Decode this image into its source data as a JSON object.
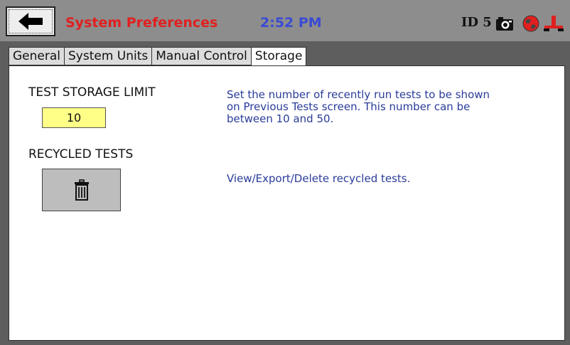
{
  "header": {
    "title": "System Preferences",
    "time": "2:52 PM",
    "id_label": "ID 5",
    "icons": [
      "back-arrow-icon",
      "camera-icon",
      "globe-icon",
      "network-icon"
    ]
  },
  "tabs": [
    {
      "label": "General",
      "active": false
    },
    {
      "label": "System Units",
      "active": false
    },
    {
      "label": "Manual Control",
      "active": false
    },
    {
      "label": "Storage",
      "active": true
    }
  ],
  "storage": {
    "limit_label": "TEST STORAGE LIMIT",
    "limit_value": "10",
    "limit_desc_lines": [
      "Set the number of recently run tests to be shown",
      "on Previous Tests screen. This number can be",
      "between 10 and 50."
    ],
    "recycled_label": "RECYCLED TESTS",
    "recycled_desc": "View/Export/Delete recycled tests."
  },
  "colors": {
    "title": "#e02020",
    "clock": "#3a4bd4",
    "description": "#2a3c9a",
    "input_bg": "#ffff88",
    "header_bg": "#8d8d8d"
  }
}
